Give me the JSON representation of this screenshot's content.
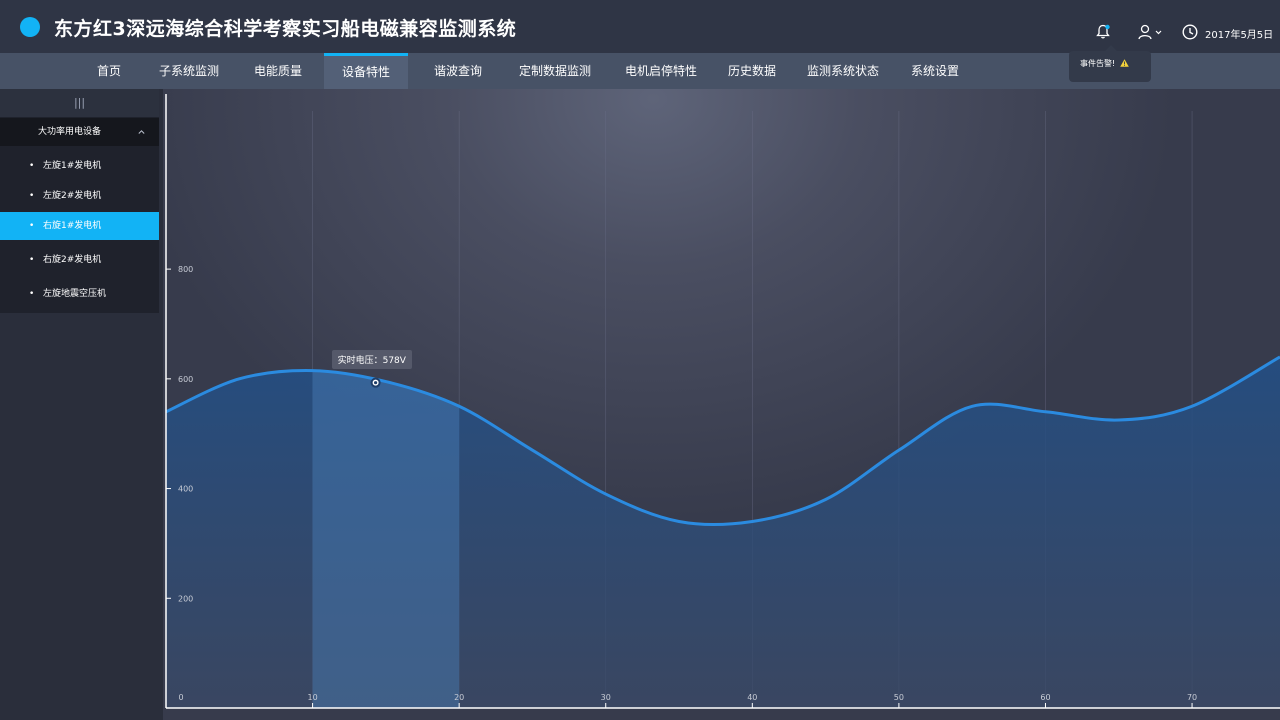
{
  "header": {
    "title": "东方红3深远海综合科学考察实习船电磁兼容监测系统",
    "date": "2017年5月5日",
    "alert_text": "事件告警!",
    "colors": {
      "accent": "#12b3f5",
      "header_bg": "#2f3545",
      "nav_bg": "#475266"
    }
  },
  "nav": {
    "items": [
      {
        "label": "首页"
      },
      {
        "label": "子系统监测"
      },
      {
        "label": "电能质量"
      },
      {
        "label": "设备特性",
        "active": true
      },
      {
        "label": "谐波查询"
      },
      {
        "label": "定制数据监测"
      },
      {
        "label": "电机启停特性"
      },
      {
        "label": "历史数据"
      },
      {
        "label": "监测系统状态"
      },
      {
        "label": "系统设置"
      }
    ]
  },
  "sidebar": {
    "handle": "|||",
    "group_label": "大功率用电设备",
    "items": [
      {
        "label": "左旋1#发电机"
      },
      {
        "label": "左旋2#发电机"
      },
      {
        "label": "右旋1#发电机",
        "active": true
      },
      {
        "label": "右旋2#发电机"
      },
      {
        "label": "左旋地震空压机"
      }
    ]
  },
  "chart_data": {
    "type": "area",
    "x_ticks": [
      "0",
      "10",
      "20",
      "30",
      "40",
      "50",
      "60",
      "70"
    ],
    "y_ticks": [
      "200",
      "400",
      "600",
      "800"
    ],
    "xlim": [
      0,
      76
    ],
    "ylim": [
      0,
      1000
    ],
    "highlight_range": [
      10,
      20
    ],
    "series": [
      {
        "x": [
          0,
          5,
          10,
          15,
          20,
          25,
          30,
          35,
          40,
          45,
          50,
          55,
          60,
          65,
          70,
          76
        ],
        "y": [
          540,
          600,
          615,
          595,
          550,
          470,
          390,
          340,
          340,
          380,
          470,
          550,
          540,
          525,
          550,
          640
        ]
      }
    ],
    "tooltip": {
      "x": 14.3,
      "y": 593,
      "text": "实时电压：578V"
    },
    "colors": {
      "line": "#2b8be0",
      "area": "#2a5d92"
    }
  }
}
